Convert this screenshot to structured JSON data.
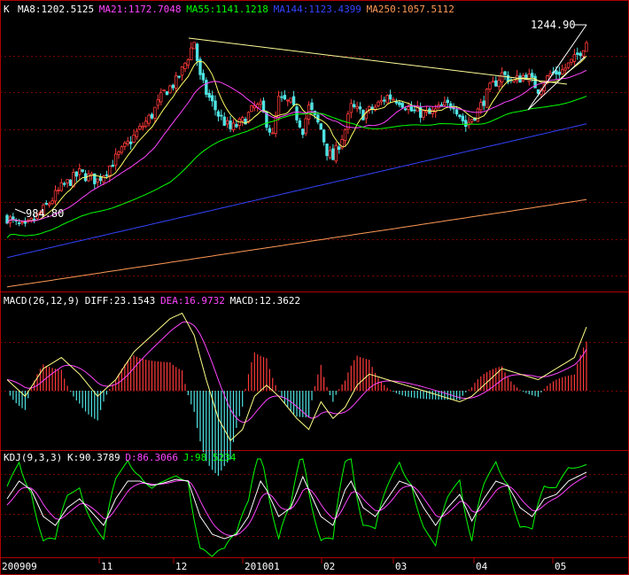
{
  "colors": {
    "bg": "#000000",
    "frame": "#b00000",
    "grid": "#7a0000",
    "up": "#ff3a3a",
    "down": "#4fe3e3",
    "ma8": "#ffffff",
    "ma21": "#ffff66",
    "ma55": "#ff44ff",
    "ma144": "#00ff00",
    "ma250": "#3344ff",
    "ma_long": "#ff9955",
    "diff": "#ffff88",
    "dea": "#ff44ff",
    "macd_up": "#ff3a3a",
    "macd_down": "#4fe3e3",
    "k": "#ffffff",
    "d": "#ff44ff",
    "j": "#00ff00",
    "axis_text": "#ffffff",
    "trend": "#ffff99"
  },
  "price_panel": {
    "tag": "K",
    "legend": [
      {
        "text": "MA8:1202.5125",
        "color": "#ffffff"
      },
      {
        "text": "MA21:1172.7048",
        "color": "#ff44ff"
      },
      {
        "text": "MA55:1141.1218",
        "color": "#00ff00"
      },
      {
        "text": "MA144:1123.4399",
        "color": "#3344ff"
      },
      {
        "text": "MA250:1057.5112",
        "color": "#ff9955"
      }
    ],
    "high_label": "1244.90",
    "low_label": "984.80"
  },
  "macd_panel": {
    "legend": [
      {
        "text": "MACD(26,12,9)",
        "color": "#ffffff"
      },
      {
        "text": "DIFF:23.1543",
        "color": "#ffffff"
      },
      {
        "text": "DEA:16.9732",
        "color": "#ff44ff"
      },
      {
        "text": "MACD:12.3622",
        "color": "#ffffff"
      }
    ]
  },
  "kdj_panel": {
    "legend": [
      {
        "text": "KDJ(9,3,3)",
        "color": "#ffffff"
      },
      {
        "text": "K:90.3789",
        "color": "#ffffff"
      },
      {
        "text": "D:86.3066",
        "color": "#ff44ff"
      },
      {
        "text": "J:98.5234",
        "color": "#00ff00"
      }
    ]
  },
  "x_axis": {
    "ticks": [
      "200909",
      "11",
      "12",
      "201001",
      "02",
      "03",
      "04",
      "05"
    ]
  },
  "chart_data": {
    "type": "candlestick",
    "price_range": [
      900,
      1260
    ],
    "low_mark": 984.8,
    "high_mark": 1244.9,
    "price_keypoints": [
      [
        0,
        1000
      ],
      [
        3,
        990
      ],
      [
        6,
        985
      ],
      [
        12,
        1010
      ],
      [
        18,
        1040
      ],
      [
        24,
        1060
      ],
      [
        30,
        1050
      ],
      [
        36,
        1080
      ],
      [
        42,
        1110
      ],
      [
        48,
        1140
      ],
      [
        52,
        1170
      ],
      [
        56,
        1185
      ],
      [
        58,
        1200
      ],
      [
        60,
        1220
      ],
      [
        62,
        1240
      ],
      [
        64,
        1190
      ],
      [
        66,
        1170
      ],
      [
        70,
        1140
      ],
      [
        74,
        1120
      ],
      [
        78,
        1130
      ],
      [
        82,
        1150
      ],
      [
        84,
        1150
      ],
      [
        88,
        1110
      ],
      [
        90,
        1160
      ],
      [
        94,
        1155
      ],
      [
        98,
        1120
      ],
      [
        100,
        1150
      ],
      [
        104,
        1120
      ],
      [
        106,
        1090
      ],
      [
        108,
        1080
      ],
      [
        112,
        1120
      ],
      [
        114,
        1150
      ],
      [
        118,
        1140
      ],
      [
        122,
        1150
      ],
      [
        126,
        1165
      ],
      [
        130,
        1160
      ],
      [
        134,
        1145
      ],
      [
        140,
        1140
      ],
      [
        144,
        1150
      ],
      [
        148,
        1155
      ],
      [
        152,
        1125
      ],
      [
        156,
        1145
      ],
      [
        160,
        1175
      ],
      [
        164,
        1195
      ],
      [
        168,
        1185
      ],
      [
        172,
        1195
      ],
      [
        176,
        1175
      ],
      [
        180,
        1195
      ],
      [
        184,
        1200
      ],
      [
        188,
        1215
      ],
      [
        192,
        1240
      ]
    ],
    "macd_keypoints": [
      [
        0,
        4
      ],
      [
        6,
        -2
      ],
      [
        12,
        8
      ],
      [
        18,
        12
      ],
      [
        24,
        6
      ],
      [
        30,
        -2
      ],
      [
        36,
        4
      ],
      [
        42,
        14
      ],
      [
        48,
        20
      ],
      [
        54,
        26
      ],
      [
        58,
        28
      ],
      [
        62,
        20
      ],
      [
        66,
        4
      ],
      [
        70,
        -10
      ],
      [
        74,
        -18
      ],
      [
        78,
        -14
      ],
      [
        82,
        -2
      ],
      [
        86,
        2
      ],
      [
        90,
        -2
      ],
      [
        96,
        -10
      ],
      [
        100,
        -14
      ],
      [
        104,
        -4
      ],
      [
        108,
        -10
      ],
      [
        112,
        -6
      ],
      [
        116,
        2
      ],
      [
        120,
        6
      ],
      [
        126,
        4
      ],
      [
        132,
        2
      ],
      [
        138,
        0
      ],
      [
        144,
        -2
      ],
      [
        150,
        -4
      ],
      [
        154,
        -2
      ],
      [
        158,
        2
      ],
      [
        164,
        8
      ],
      [
        170,
        6
      ],
      [
        176,
        4
      ],
      [
        182,
        8
      ],
      [
        188,
        12
      ],
      [
        192,
        23
      ]
    ],
    "macd_range": [
      -30,
      32
    ],
    "kdj_keypoints": [
      [
        0,
        60
      ],
      [
        4,
        80
      ],
      [
        8,
        70
      ],
      [
        12,
        40
      ],
      [
        16,
        30
      ],
      [
        20,
        50
      ],
      [
        24,
        60
      ],
      [
        28,
        45
      ],
      [
        32,
        30
      ],
      [
        36,
        60
      ],
      [
        40,
        80
      ],
      [
        44,
        80
      ],
      [
        48,
        75
      ],
      [
        52,
        78
      ],
      [
        56,
        82
      ],
      [
        60,
        80
      ],
      [
        64,
        40
      ],
      [
        68,
        20
      ],
      [
        72,
        15
      ],
      [
        76,
        20
      ],
      [
        80,
        40
      ],
      [
        84,
        80
      ],
      [
        86,
        70
      ],
      [
        90,
        40
      ],
      [
        94,
        50
      ],
      [
        98,
        85
      ],
      [
        100,
        70
      ],
      [
        104,
        40
      ],
      [
        108,
        30
      ],
      [
        112,
        70
      ],
      [
        114,
        80
      ],
      [
        118,
        50
      ],
      [
        122,
        40
      ],
      [
        126,
        60
      ],
      [
        130,
        80
      ],
      [
        134,
        75
      ],
      [
        138,
        50
      ],
      [
        142,
        30
      ],
      [
        146,
        50
      ],
      [
        150,
        65
      ],
      [
        154,
        35
      ],
      [
        158,
        60
      ],
      [
        162,
        80
      ],
      [
        166,
        75
      ],
      [
        170,
        50
      ],
      [
        174,
        40
      ],
      [
        178,
        60
      ],
      [
        182,
        65
      ],
      [
        186,
        80
      ],
      [
        192,
        90
      ]
    ],
    "kdj_range": [
      -5,
      105
    ]
  }
}
